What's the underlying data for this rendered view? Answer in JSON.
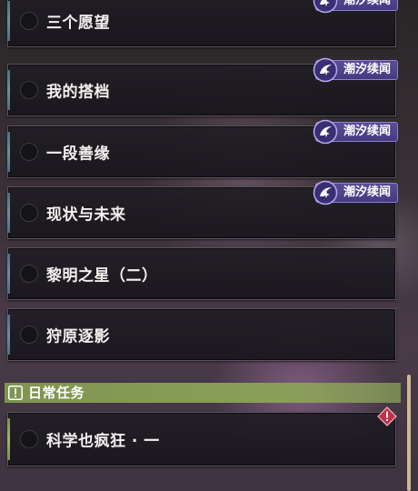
{
  "quests": [
    {
      "title": "三个愿望",
      "tag": "潮汐续闻"
    },
    {
      "title": "我的搭档",
      "tag": "潮汐续闻"
    },
    {
      "title": "一段善缘",
      "tag": "潮汐续闻"
    },
    {
      "title": "现状与未来",
      "tag": "潮汐续闻"
    },
    {
      "title": "黎明之星（二）"
    },
    {
      "title": "狩原逐影"
    }
  ],
  "daily_section": {
    "label": "日常任务",
    "icon": "exclamation-icon",
    "color": "#8aa05a",
    "quests": [
      {
        "title": "科学也疯狂 · 一",
        "alert_icon": "diamond-alert-icon",
        "alert_color": "#c2324a"
      }
    ]
  },
  "colors": {
    "tag_bg": "#4e4289",
    "tag_border": "#8e80d0",
    "accent_blue": "#6f8ea3",
    "scrollbar": "#cdb88f"
  }
}
